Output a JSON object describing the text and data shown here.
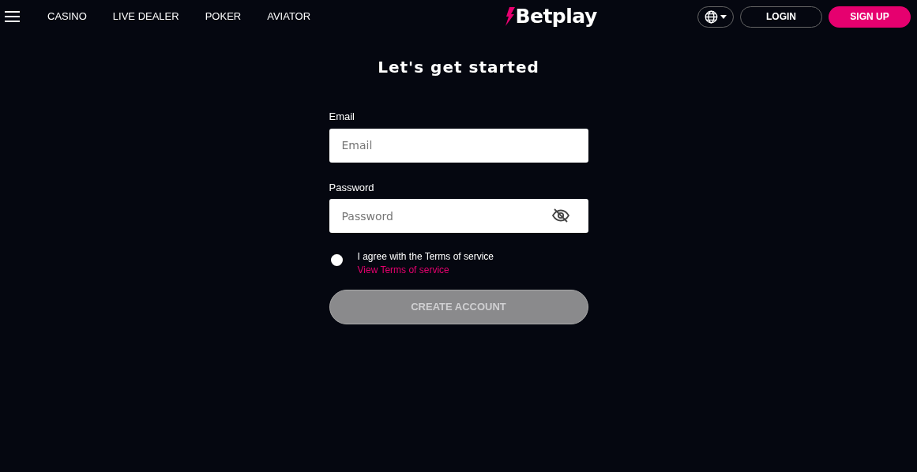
{
  "nav": {
    "links": [
      "CASINO",
      "LIVE DEALER",
      "POKER",
      "AVIATOR"
    ],
    "logo": "Betplay",
    "login": "LOGIN",
    "signup": "SIGN UP"
  },
  "form": {
    "title": "Let's get started",
    "fields": [
      {
        "label": "Email",
        "placeholder": "Email",
        "kind": "text"
      },
      {
        "label": "Password",
        "placeholder": "Password",
        "kind": "password"
      }
    ],
    "agree": {
      "checked": false,
      "text": "I agree with the Terms of service",
      "link": "View Terms of service"
    },
    "submit": {
      "label": "CREATE ACCOUNT",
      "disabled": true
    }
  }
}
